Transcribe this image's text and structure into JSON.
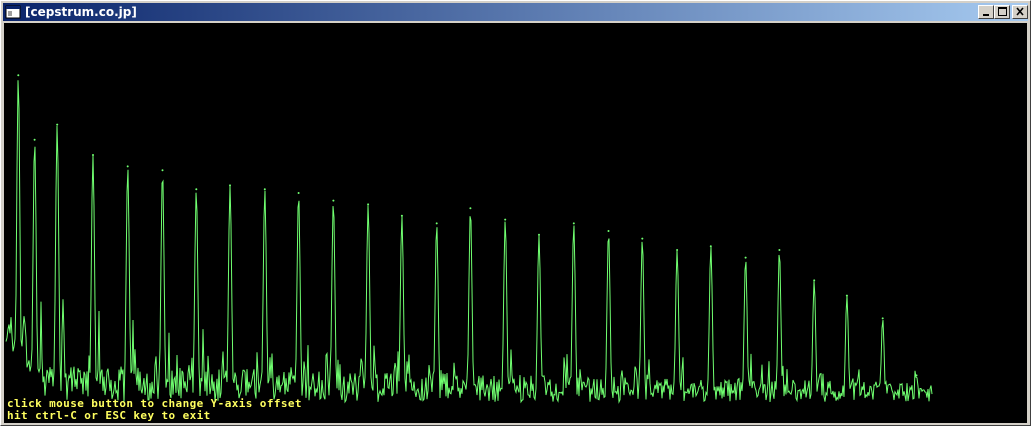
{
  "window": {
    "title": "[cepstrum.co.jp]",
    "buttons": [
      "minimize-icon",
      "maximize-icon",
      "close-icon"
    ]
  },
  "overlay": {
    "line1": "click mouse button to change Y-axis offset",
    "line2": "hit ctrl-C or ESC key to exit"
  },
  "colors": {
    "trace": "#70ff70",
    "background": "#000000",
    "overlay_text": "#ffff60"
  },
  "chart_data": {
    "type": "line",
    "title": "",
    "xlabel": "",
    "ylabel": "",
    "grid": false,
    "peaks": [
      {
        "x": 0.012,
        "y": 0.91
      },
      {
        "x": 0.028,
        "y": 0.74
      },
      {
        "x": 0.05,
        "y": 0.78
      },
      {
        "x": 0.085,
        "y": 0.7
      },
      {
        "x": 0.119,
        "y": 0.67
      },
      {
        "x": 0.153,
        "y": 0.66
      },
      {
        "x": 0.186,
        "y": 0.61
      },
      {
        "x": 0.219,
        "y": 0.62
      },
      {
        "x": 0.253,
        "y": 0.61
      },
      {
        "x": 0.286,
        "y": 0.6
      },
      {
        "x": 0.32,
        "y": 0.58
      },
      {
        "x": 0.354,
        "y": 0.57
      },
      {
        "x": 0.387,
        "y": 0.54
      },
      {
        "x": 0.421,
        "y": 0.52
      },
      {
        "x": 0.454,
        "y": 0.56
      },
      {
        "x": 0.488,
        "y": 0.53
      },
      {
        "x": 0.521,
        "y": 0.49
      },
      {
        "x": 0.555,
        "y": 0.52
      },
      {
        "x": 0.589,
        "y": 0.5
      },
      {
        "x": 0.622,
        "y": 0.48
      },
      {
        "x": 0.656,
        "y": 0.45
      },
      {
        "x": 0.689,
        "y": 0.46
      },
      {
        "x": 0.723,
        "y": 0.43
      },
      {
        "x": 0.756,
        "y": 0.45
      },
      {
        "x": 0.79,
        "y": 0.37
      },
      {
        "x": 0.822,
        "y": 0.33
      },
      {
        "x": 0.857,
        "y": 0.27
      },
      {
        "x": 0.89,
        "y": 0.12
      }
    ]
  }
}
